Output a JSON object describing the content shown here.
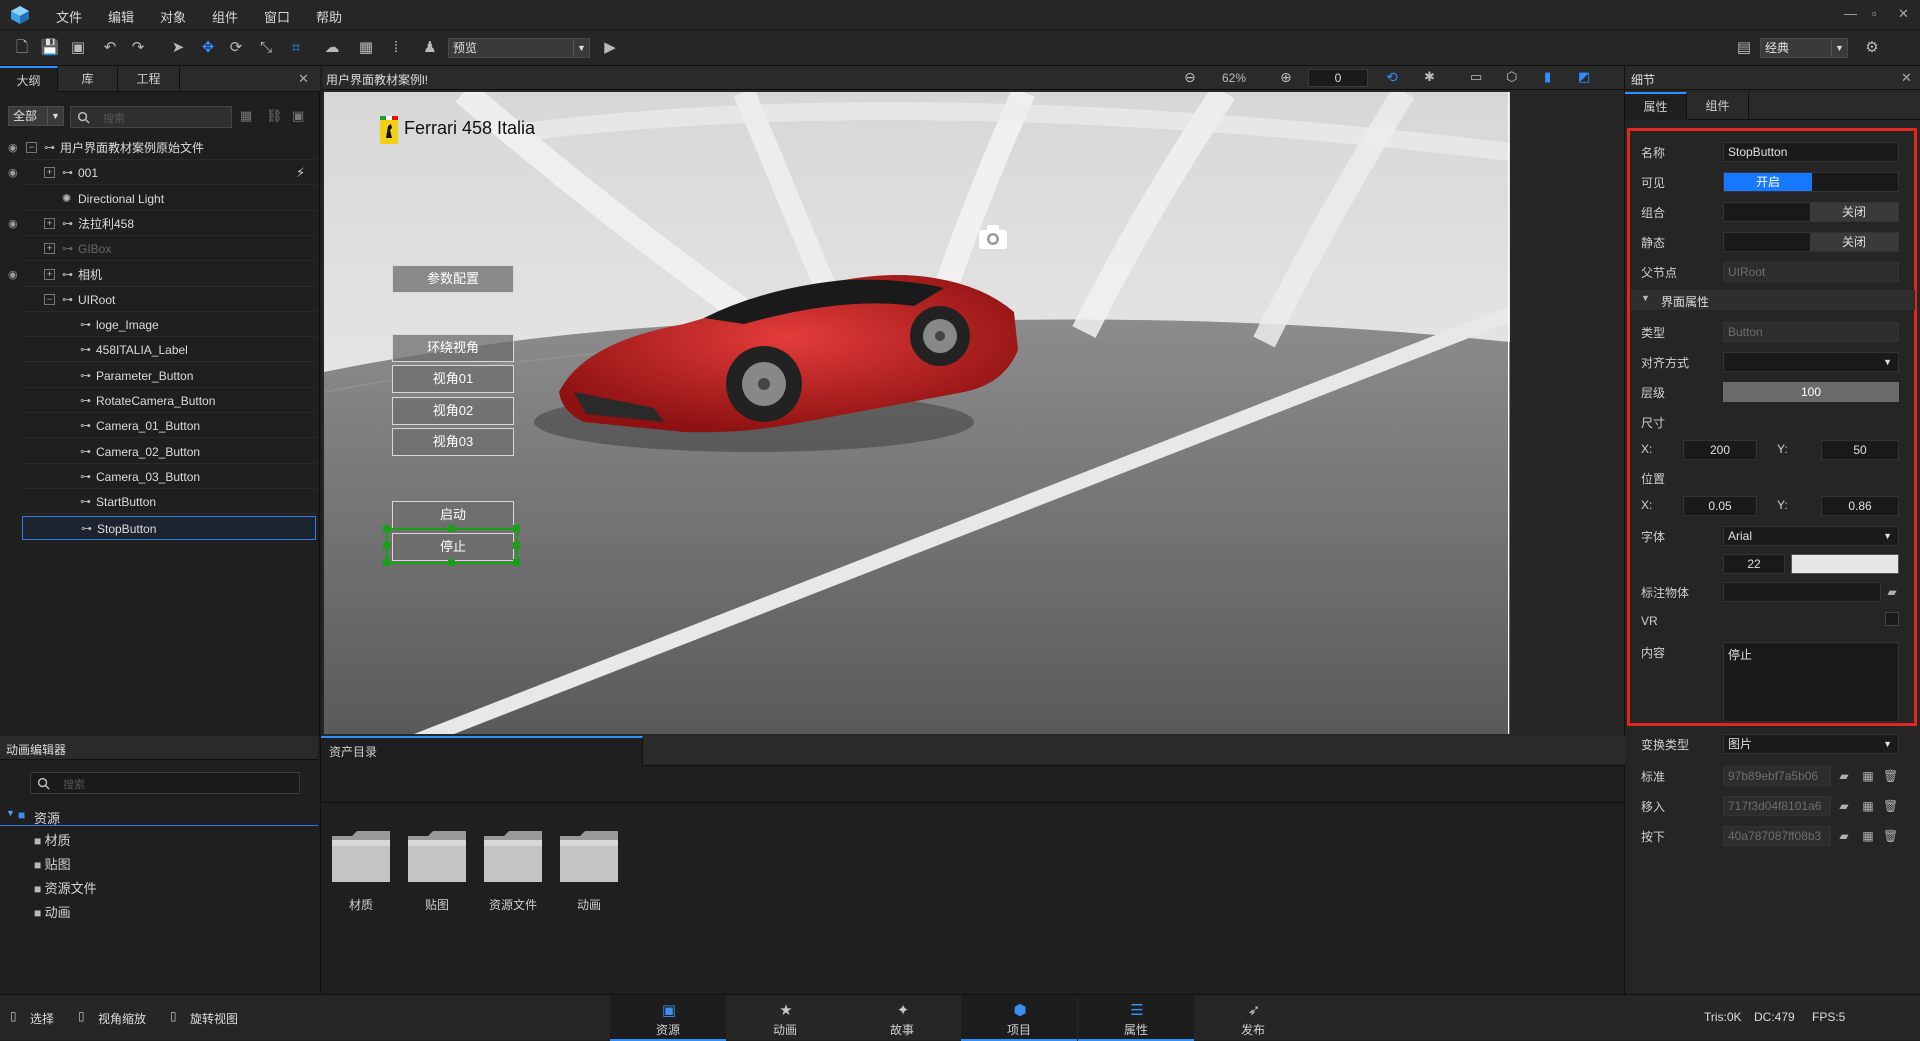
{
  "menubar": {
    "items": [
      "文件",
      "编辑",
      "对象",
      "组件",
      "窗口",
      "帮助"
    ],
    "window_controls": [
      "—",
      "▫",
      "✕"
    ]
  },
  "toolbar": {
    "mode_select": "预览",
    "layout_select": "经典"
  },
  "outline": {
    "tabs": [
      "大纲",
      "库",
      "工程"
    ],
    "filter_select": "全部",
    "search_placeholder": "搜索",
    "rows": [
      {
        "label": "用户界面教材案例原始文件",
        "indent": 0,
        "expander": "−",
        "eye": true,
        "dim": false
      },
      {
        "label": "001",
        "indent": 1,
        "expander": "+",
        "eye": true,
        "dim": false
      },
      {
        "label": "Directional Light",
        "indent": 1,
        "expander": "",
        "eye": false,
        "dim": false
      },
      {
        "label": "法拉利458",
        "indent": 1,
        "expander": "+",
        "eye": true,
        "dim": false
      },
      {
        "label": "GIBox",
        "indent": 1,
        "expander": "+",
        "eye": false,
        "dim": true
      },
      {
        "label": "相机",
        "indent": 1,
        "expander": "+",
        "eye": true,
        "dim": false
      },
      {
        "label": "UIRoot",
        "indent": 1,
        "expander": "−",
        "eye": false,
        "dim": false
      },
      {
        "label": "loge_Image",
        "indent": 2,
        "expander": "",
        "eye": false,
        "dim": false
      },
      {
        "label": "458ITALIA_Label",
        "indent": 2,
        "expander": "",
        "eye": false,
        "dim": false
      },
      {
        "label": "Parameter_Button",
        "indent": 2,
        "expander": "",
        "eye": false,
        "dim": false
      },
      {
        "label": "RotateCamera_Button",
        "indent": 2,
        "expander": "",
        "eye": false,
        "dim": false
      },
      {
        "label": "Camera_01_Button",
        "indent": 2,
        "expander": "",
        "eye": false,
        "dim": false
      },
      {
        "label": "Camera_02_Button",
        "indent": 2,
        "expander": "",
        "eye": false,
        "dim": false
      },
      {
        "label": "Camera_03_Button",
        "indent": 2,
        "expander": "",
        "eye": false,
        "dim": false
      },
      {
        "label": "StartButton",
        "indent": 2,
        "expander": "",
        "eye": false,
        "dim": false
      },
      {
        "label": "StopButton",
        "indent": 2,
        "expander": "",
        "eye": false,
        "dim": false,
        "selected": true
      }
    ]
  },
  "viewport": {
    "title": "用户界面教材案例l!",
    "zoom": "62%",
    "rotation_value": "0",
    "scene_title": "Ferrari 458 Italia",
    "buttons": [
      {
        "label": "参数配置"
      },
      {
        "label": "环绕视角"
      },
      {
        "label": "视角01"
      },
      {
        "label": "视角02"
      },
      {
        "label": "视角03"
      },
      {
        "label": "启动"
      },
      {
        "label": "停止",
        "selected": true
      }
    ]
  },
  "details": {
    "title": "细节",
    "tabs": [
      "属性",
      "组件"
    ],
    "name_label": "名称",
    "name_value": "StopButton",
    "visible_label": "可见",
    "visible_value": "开启",
    "group_label": "组合",
    "group_value": "关闭",
    "static_label": "静态",
    "static_value": "关闭",
    "parent_label": "父节点",
    "parent_value": "UIRoot",
    "section_title": "界面属性",
    "type_label": "类型",
    "type_value": "Button",
    "align_label": "对齐方式",
    "align_value": "",
    "layer_label": "层级",
    "layer_value": "100",
    "size_label": "尺寸",
    "size_x": "200",
    "size_y": "50",
    "pos_label": "位置",
    "pos_x": "0.05",
    "pos_y": "0.86",
    "x_label": "X:",
    "y_label": "Y:",
    "font_label": "字体",
    "font_value": "Arial",
    "font_size": "22",
    "anchor_label": "标注物体",
    "vr_label": "VR",
    "content_label": "内容",
    "content_value": "停止",
    "transform_label": "变换类型",
    "transform_value": "图片",
    "normal_label": "标准",
    "normal_value": "97b89ebf7a5b06",
    "hover_label": "移入",
    "hover_value": "717f3d04f8101a6",
    "press_label": "按下",
    "press_value": "40a787087ff08b3",
    "highlight_color": "#e0261d"
  },
  "anim_editor": {
    "title": "动画编辑器",
    "search_placeholder": "搜索",
    "root": "资源",
    "children": [
      "材质",
      "贴图",
      "资源文件",
      "动画"
    ]
  },
  "assets": {
    "tab": "资产目录",
    "folders": [
      "材质",
      "贴图",
      "资源文件",
      "动画"
    ]
  },
  "status": {
    "tools": [
      "选择",
      "视角缩放",
      "旋转视图"
    ],
    "tabs": [
      {
        "label": "资源",
        "icon": "box-icon",
        "selected": true
      },
      {
        "label": "动画",
        "icon": "star-icon",
        "selected": false
      },
      {
        "label": "故事",
        "icon": "wand-icon",
        "selected": false
      },
      {
        "label": "项目",
        "icon": "cube-icon",
        "selected": true
      },
      {
        "label": "属性",
        "icon": "sliders-icon",
        "selected": true
      },
      {
        "label": "发布",
        "icon": "rocket-icon",
        "selected": false
      }
    ],
    "tris": "Tris:0K",
    "dc": "DC:479",
    "fps": "FPS:5"
  }
}
